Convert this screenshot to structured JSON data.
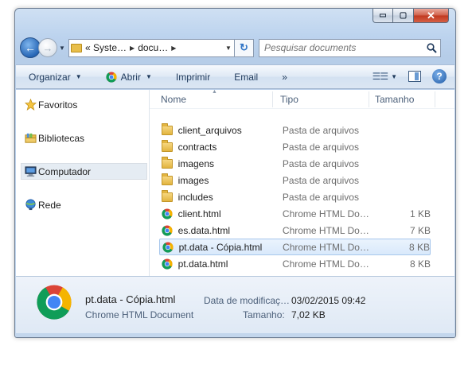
{
  "window": {
    "caption_buttons": {
      "minimize": "▭",
      "maximize": "▢",
      "close": "✕"
    }
  },
  "address_bar": {
    "segments": [
      "« Syste…",
      "docu…"
    ],
    "search_placeholder": "Pesquisar documents"
  },
  "toolbar": {
    "organize": "Organizar",
    "open": "Abrir",
    "print": "Imprimir",
    "email": "Email",
    "more": "»"
  },
  "sidebar": {
    "items": [
      {
        "label": "Favoritos",
        "icon": "star-icon"
      },
      {
        "label": "Bibliotecas",
        "icon": "libraries-icon"
      },
      {
        "label": "Computador",
        "icon": "computer-icon",
        "selected": true
      },
      {
        "label": "Rede",
        "icon": "network-icon"
      }
    ]
  },
  "columns": {
    "name": "Nome",
    "type": "Tipo",
    "size": "Tamanho"
  },
  "files": [
    {
      "name": "client_arquivos",
      "type": "Pasta de arquivos",
      "size": "",
      "icon": "folder-icon"
    },
    {
      "name": "contracts",
      "type": "Pasta de arquivos",
      "size": "",
      "icon": "folder-icon"
    },
    {
      "name": "imagens",
      "type": "Pasta de arquivos",
      "size": "",
      "icon": "folder-icon"
    },
    {
      "name": "images",
      "type": "Pasta de arquivos",
      "size": "",
      "icon": "folder-icon"
    },
    {
      "name": "includes",
      "type": "Pasta de arquivos",
      "size": "",
      "icon": "folder-icon"
    },
    {
      "name": "client.html",
      "type": "Chrome HTML Do…",
      "size": "1 KB",
      "icon": "chrome-icon"
    },
    {
      "name": "es.data.html",
      "type": "Chrome HTML Do…",
      "size": "7 KB",
      "icon": "chrome-icon"
    },
    {
      "name": "pt.data - Cópia.html",
      "type": "Chrome HTML Do…",
      "size": "8 KB",
      "icon": "chrome-icon",
      "selected": true
    },
    {
      "name": "pt.data.html",
      "type": "Chrome HTML Do…",
      "size": "8 KB",
      "icon": "chrome-icon"
    }
  ],
  "details": {
    "name": "pt.data - Cópia.html",
    "type": "Chrome HTML Document",
    "modified_label": "Data de modificaç…",
    "modified_value": "03/02/2015 09:42",
    "size_label": "Tamanho:",
    "size_value": "7,02 KB"
  }
}
